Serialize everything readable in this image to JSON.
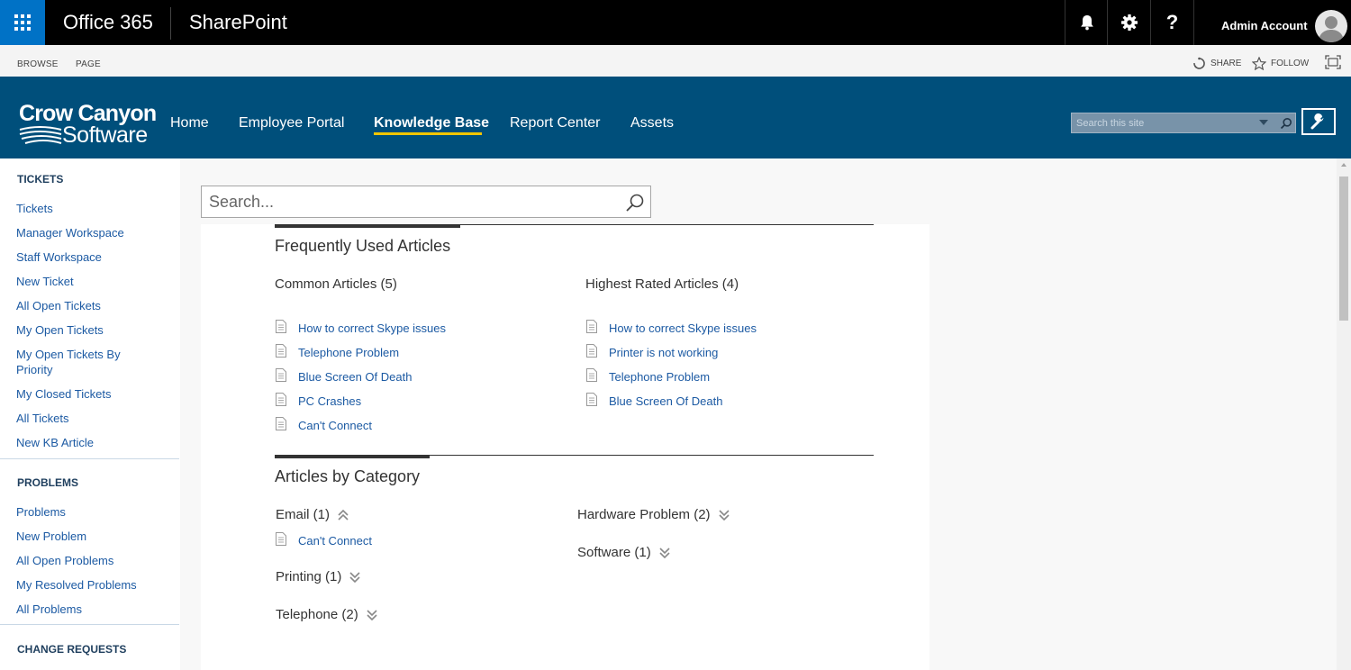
{
  "suite_bar": {
    "app_launcher_icon": "waffle-icon",
    "brand": "Office 365",
    "app_name": "SharePoint",
    "notification_icon": "bell-icon",
    "settings_icon": "gear-icon",
    "help_label": "?",
    "user_name": "Admin Account",
    "avatar_icon": "user-icon",
    "background_color": "#000000",
    "launcher_color": "#0072c6"
  },
  "ribbon": {
    "tabs": [
      "BROWSE",
      "PAGE"
    ],
    "share_label": "SHARE",
    "follow_label": "FOLLOW",
    "focus_icon": "focus-on-content-icon"
  },
  "site_header": {
    "background_color": "#004f7b",
    "logo_line1": "Crow Canyon",
    "logo_line2": "Software",
    "nav": [
      "Home",
      "Employee Portal",
      "Knowledge Base",
      "Report Center",
      "Assets"
    ],
    "active_nav": "Knowledge Base",
    "active_underline_color": "#f2c500",
    "search_placeholder": "Search this site",
    "search_icon": "magnifier-icon",
    "settings_icon": "wrench-icon"
  },
  "left_nav": {
    "sections": [
      {
        "header": "TICKETS",
        "items": [
          "Tickets",
          "Manager Workspace",
          "Staff Workspace",
          "New Ticket",
          "All Open Tickets",
          "My Open Tickets",
          "My Open Tickets By Priority",
          "My Closed Tickets",
          "All Tickets",
          "New KB Article"
        ]
      },
      {
        "header": "PROBLEMS",
        "items": [
          "Problems",
          "New Problem",
          "All Open Problems",
          "My Resolved Problems",
          "All Problems"
        ]
      },
      {
        "header": "CHANGE REQUESTS",
        "items": []
      }
    ]
  },
  "kb": {
    "search_placeholder": "Search...",
    "frequently_used": {
      "title": "Frequently Used Articles",
      "common": {
        "title": "Common Articles (5)",
        "articles": [
          "How to correct Skype issues",
          "Telephone Problem",
          "Blue Screen Of Death",
          "PC Crashes",
          "Can't Connect"
        ]
      },
      "highest_rated": {
        "title": "Highest Rated Articles (4)",
        "articles": [
          "How to correct Skype issues",
          "Printer is not working",
          "Telephone Problem",
          "Blue Screen Of Death"
        ]
      }
    },
    "by_category": {
      "title": "Articles by Category",
      "categories": [
        {
          "label": "Email (1)",
          "expanded": true,
          "articles": [
            "Can't Connect"
          ]
        },
        {
          "label": "Printing (1)",
          "expanded": false
        },
        {
          "label": "Telephone (2)",
          "expanded": false
        },
        {
          "label": "Hardware Problem (2)",
          "expanded": false
        },
        {
          "label": "Software (1)",
          "expanded": false
        }
      ]
    },
    "link_color": "#1c5aa3"
  }
}
